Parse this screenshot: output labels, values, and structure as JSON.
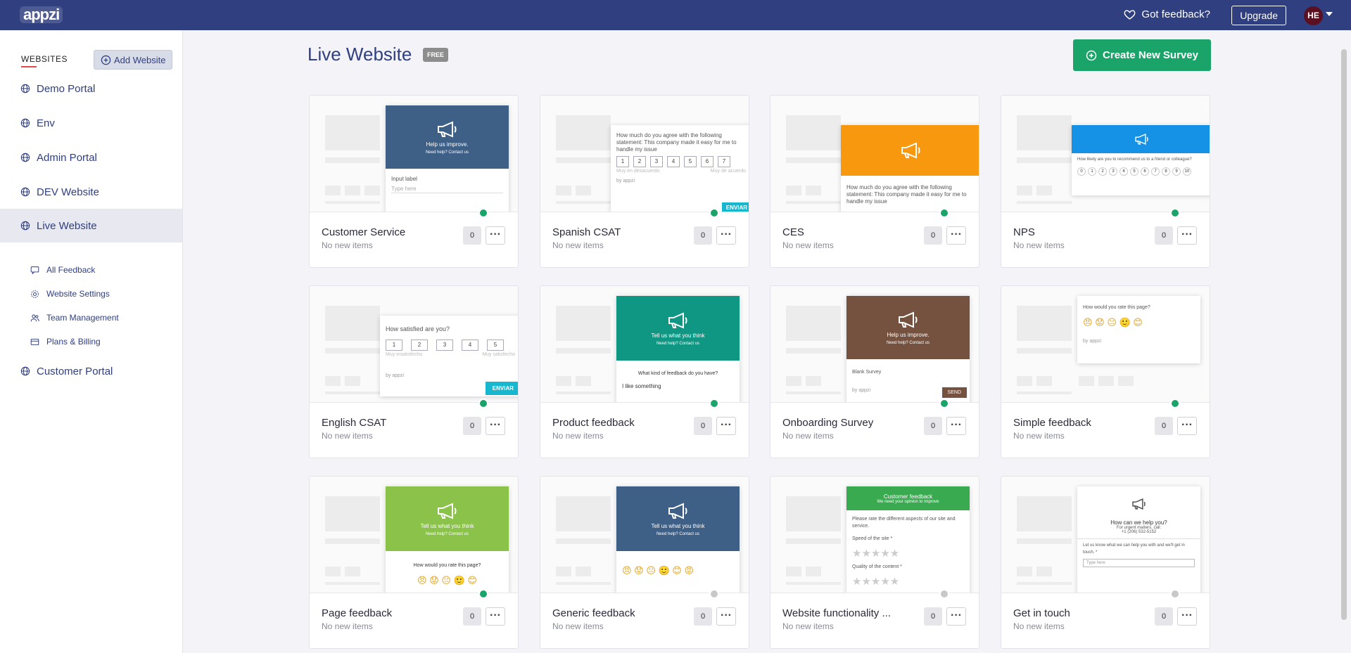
{
  "header": {
    "logo": "appzi",
    "feedback_label": "Got feedback?",
    "upgrade_label": "Upgrade",
    "avatar_initials": "HE"
  },
  "sidebar": {
    "heading": "WEBSITES",
    "add_website_label": "Add Website",
    "items": [
      {
        "label": "Demo Portal"
      },
      {
        "label": "Env"
      },
      {
        "label": "Admin Portal"
      },
      {
        "label": "DEV Website"
      },
      {
        "label": "Live Website",
        "active": true
      },
      {
        "label": "Customer Portal"
      }
    ],
    "sub_items": [
      {
        "label": "All Feedback",
        "icon": "chat-icon"
      },
      {
        "label": "Website Settings",
        "icon": "gear-icon"
      },
      {
        "label": "Team Management",
        "icon": "users-icon"
      },
      {
        "label": "Plans & Billing",
        "icon": "card-icon"
      }
    ]
  },
  "main": {
    "title": "Live Website",
    "badge": "FREE",
    "create_label": "Create New Survey"
  },
  "cards": [
    {
      "name": "Customer Service",
      "sub": "No new items",
      "count": "0",
      "status": "active",
      "preview": {
        "head_text": "Help us improve.",
        "sub_text": "Need help? Contact us",
        "body": "Input label",
        "placeholder": "Type here"
      }
    },
    {
      "name": "Spanish CSAT",
      "sub": "No new items",
      "count": "0",
      "status": "active",
      "preview": {
        "question": "How much do you agree with the following statement: This company made it easy for me to handle my issue",
        "scale": [
          "1",
          "2",
          "3",
          "4",
          "5",
          "6",
          "7"
        ],
        "low": "Muy en desacuerdo",
        "high": "Muy de acuerdo",
        "button": "ENVIAR",
        "by": "by appzi"
      }
    },
    {
      "name": "CES",
      "sub": "No new items",
      "count": "0",
      "status": "active",
      "preview": {
        "question": "How much do you agree with the following statement: This company made it easy for me to handle my issue"
      }
    },
    {
      "name": "NPS",
      "sub": "No new items",
      "count": "0",
      "status": "active",
      "preview": {
        "question": "How likely are you to recommend us to a friend or colleague?",
        "scale": [
          "0",
          "1",
          "2",
          "3",
          "4",
          "5",
          "6",
          "7",
          "8",
          "9",
          "10"
        ]
      }
    },
    {
      "name": "English CSAT",
      "sub": "No new items",
      "count": "0",
      "status": "active",
      "preview": {
        "question": "How satisfied are you?",
        "scale": [
          "1",
          "2",
          "3",
          "4",
          "5"
        ],
        "low": "Muy insatisfecho",
        "high": "Muy satisfecho",
        "button": "ENVIAR",
        "by": "by appzi"
      }
    },
    {
      "name": "Product feedback",
      "sub": "No new items",
      "count": "0",
      "status": "active",
      "preview": {
        "head_text": "Tell us what you think",
        "sub_text": "Need help? Contact us",
        "body": "What kind of feedback do you have?",
        "option": "I like something"
      }
    },
    {
      "name": "Onboarding Survey",
      "sub": "No new items",
      "count": "0",
      "status": "active",
      "preview": {
        "head_text": "Help us improve.",
        "sub_text": "Need help? Contact us",
        "body": "Blank Survey",
        "button": "SEND",
        "by": "by appzi"
      }
    },
    {
      "name": "Simple feedback",
      "sub": "No new items",
      "count": "0",
      "status": "active",
      "preview": {
        "question": "How would you rate this page?",
        "by": "by appzi"
      }
    },
    {
      "name": "Page feedback",
      "sub": "No new items",
      "count": "0",
      "status": "active",
      "preview": {
        "head_text": "Tell us what you think",
        "sub_text": "Need help? Contact us",
        "body": "How would you rate this page?"
      }
    },
    {
      "name": "Generic feedback",
      "sub": "No new items",
      "count": "0",
      "status": "inactive",
      "preview": {
        "head_text": "Tell us what you think",
        "sub_text": "Need help? Contact us"
      }
    },
    {
      "name": "Website functionality ...",
      "sub": "No new items",
      "count": "0",
      "status": "inactive",
      "preview": {
        "head_text": "Customer feedback",
        "sub_text": "We need your opinion to improve",
        "body": "Please rate the different aspects of our site and service.",
        "label1": "Speed of the site *",
        "label2": "Quality of the content *"
      }
    },
    {
      "name": "Get in touch",
      "sub": "No new items",
      "count": "0",
      "status": "inactive",
      "preview": {
        "head_text": "How can we help you?",
        "sub_text": "For urgent matters, call:",
        "phone": "+1 (206) 532-5152",
        "body": "Let us know what we can help you with and we'll get in touch. *",
        "placeholder": "Type here"
      }
    }
  ],
  "colors": {
    "header": "#2f3f7f",
    "accent_green": "#1aa46a",
    "status_active": "#1aa46a",
    "status_inactive": "#c8c8c8"
  }
}
